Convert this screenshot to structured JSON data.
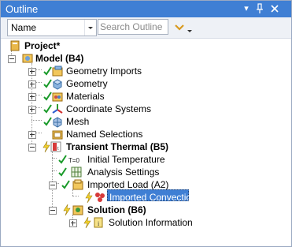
{
  "panel": {
    "title": "Outline"
  },
  "toolbar": {
    "filter_value": "Name",
    "search_placeholder": "Search Outline"
  },
  "tree": {
    "project": "Project*",
    "model": "Model (B4)",
    "geometry_imports": "Geometry Imports",
    "geometry": "Geometry",
    "materials": "Materials",
    "coordinate_systems": "Coordinate Systems",
    "mesh": "Mesh",
    "named_selections": "Named Selections",
    "transient_thermal": "Transient Thermal (B5)",
    "initial_temperature": "Initial Temperature",
    "initial_temperature_badge": "T=0",
    "analysis_settings": "Analysis Settings",
    "imported_load": "Imported Load (A2)",
    "imported_convection": "Imported Convection",
    "solution": "Solution (B6)",
    "solution_information": "Solution Information"
  }
}
